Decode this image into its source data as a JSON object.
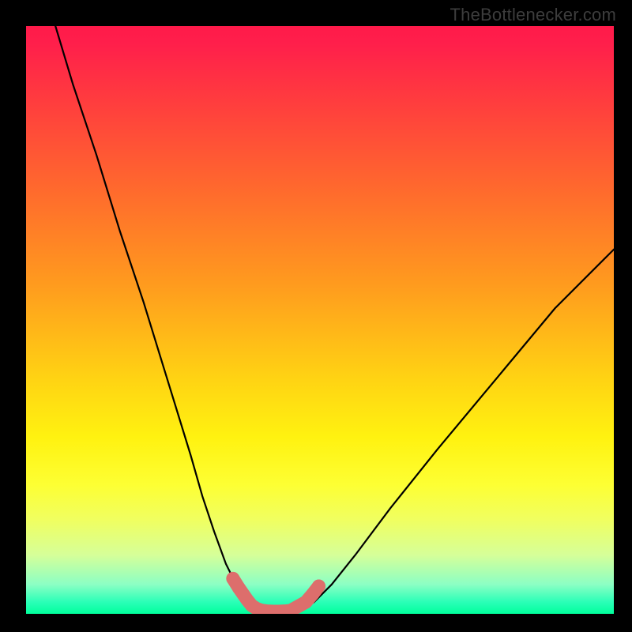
{
  "watermark": "TheBottlenecker.com",
  "gradient": {
    "css": "linear-gradient(to bottom, #ff1a4a 0%, #ff1f4b 3%, #ff3a3f 12%, #ff6a2d 28%, #ff9b1e 44%, #ffd313 60%, #fff210 70%, #fdff33 78%, #f0ff60 84%, #d6ff99 90%, #8cffc4 95%, #2affb7 98%, #00ff9c 100%)"
  },
  "curve_color": "#000000",
  "marker_color": "#dd6e6c",
  "frame_color": "#000000",
  "chart_data": {
    "type": "line",
    "title": "",
    "xlabel": "",
    "ylabel": "",
    "xlim": [
      0,
      100
    ],
    "ylim": [
      0,
      100
    ],
    "background": "vertical rainbow gradient (red top to green bottom) indicating severity/goodness scale",
    "series": [
      {
        "name": "left-branch",
        "x": [
          5,
          8,
          12,
          16,
          20,
          24,
          28,
          30,
          32,
          34,
          35.5,
          37,
          38,
          39
        ],
        "y": [
          100,
          90,
          78,
          65,
          53,
          40,
          27,
          20,
          14,
          8.5,
          5.5,
          3,
          1.5,
          0.5
        ]
      },
      {
        "name": "valley-floor",
        "x": [
          39,
          40,
          41,
          42,
          43,
          44,
          45,
          46,
          47
        ],
        "y": [
          0.5,
          0.2,
          0.1,
          0.05,
          0.05,
          0.1,
          0.2,
          0.4,
          0.8
        ]
      },
      {
        "name": "right-branch",
        "x": [
          47,
          49,
          52,
          56,
          62,
          70,
          80,
          90,
          100
        ],
        "y": [
          0.8,
          2,
          5,
          10,
          18,
          28,
          40,
          52,
          62
        ]
      }
    ],
    "markers": {
      "name": "highlighted-points",
      "color": "#dd6e6c",
      "points": [
        {
          "x": 35.2,
          "y": 6.0
        },
        {
          "x": 36.2,
          "y": 4.4
        },
        {
          "x": 37.6,
          "y": 2.4
        },
        {
          "x": 38.4,
          "y": 1.4
        },
        {
          "x": 39.2,
          "y": 0.9
        },
        {
          "x": 40.0,
          "y": 0.6
        },
        {
          "x": 41.0,
          "y": 0.45
        },
        {
          "x": 42.0,
          "y": 0.4
        },
        {
          "x": 43.0,
          "y": 0.4
        },
        {
          "x": 44.0,
          "y": 0.45
        },
        {
          "x": 45.0,
          "y": 0.55
        },
        {
          "x": 47.6,
          "y": 2.0
        },
        {
          "x": 48.8,
          "y": 3.4
        },
        {
          "x": 49.8,
          "y": 4.7
        }
      ]
    }
  }
}
